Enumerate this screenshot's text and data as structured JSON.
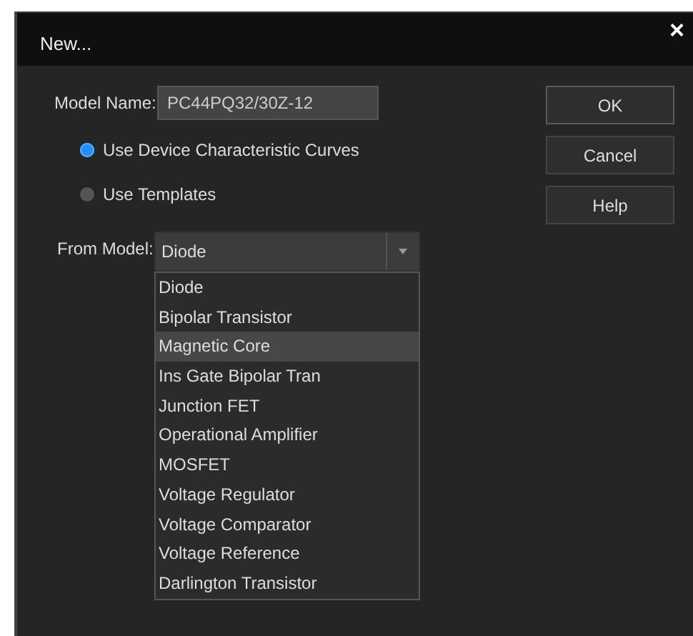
{
  "window": {
    "title": "New...",
    "close": "×"
  },
  "model_name": {
    "label": "Model Name:",
    "value": "PC44PQ32/30Z-12"
  },
  "options": [
    {
      "label": "Use Device Characteristic Curves",
      "selected": true
    },
    {
      "label": "Use Templates",
      "selected": false
    }
  ],
  "from_model": {
    "label": "From Model:",
    "value": "Diode",
    "expanded": true,
    "items": [
      {
        "label": "Diode",
        "highlighted": false
      },
      {
        "label": "Bipolar Transistor",
        "highlighted": false
      },
      {
        "label": "Magnetic Core",
        "highlighted": true
      },
      {
        "label": "Ins Gate Bipolar Tran",
        "highlighted": false
      },
      {
        "label": "Junction FET",
        "highlighted": false
      },
      {
        "label": "Operational Amplifier",
        "highlighted": false
      },
      {
        "label": "MOSFET",
        "highlighted": false
      },
      {
        "label": "Voltage Regulator",
        "highlighted": false
      },
      {
        "label": "Voltage Comparator",
        "highlighted": false
      },
      {
        "label": "Voltage Reference",
        "highlighted": false
      },
      {
        "label": "Darlington Transistor",
        "highlighted": false
      }
    ]
  },
  "buttons": [
    {
      "label": "OK",
      "default": true
    },
    {
      "label": "Cancel",
      "default": false
    },
    {
      "label": "Help",
      "default": false
    }
  ]
}
